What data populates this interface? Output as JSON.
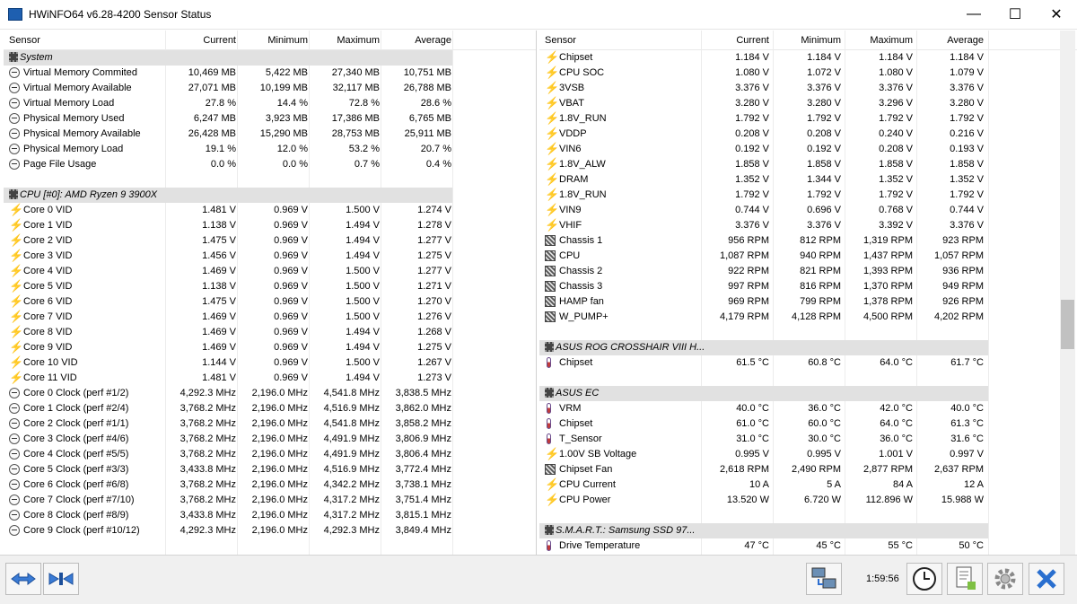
{
  "window": {
    "title": "HWiNFO64 v6.28-4200 Sensor Status",
    "minimize": "—",
    "maximize": "☐",
    "close": "✕"
  },
  "columns": {
    "sensor": "Sensor",
    "current": "Current",
    "minimum": "Minimum",
    "maximum": "Maximum",
    "average": "Average"
  },
  "left_rows": [
    {
      "type": "group",
      "name": "System",
      "icon": "chip-icon"
    },
    {
      "name": "Virtual Memory Commited",
      "icon": "clock-icon",
      "cur": "10,469 MB",
      "min": "5,422 MB",
      "max": "27,340 MB",
      "avg": "10,751 MB"
    },
    {
      "name": "Virtual Memory Available",
      "icon": "clock-icon",
      "cur": "27,071 MB",
      "min": "10,199 MB",
      "max": "32,117 MB",
      "avg": "26,788 MB"
    },
    {
      "name": "Virtual Memory Load",
      "icon": "clock-icon",
      "cur": "27.8 %",
      "min": "14.4 %",
      "max": "72.8 %",
      "avg": "28.6 %"
    },
    {
      "name": "Physical Memory Used",
      "icon": "clock-icon",
      "cur": "6,247 MB",
      "min": "3,923 MB",
      "max": "17,386 MB",
      "avg": "6,765 MB"
    },
    {
      "name": "Physical Memory Available",
      "icon": "clock-icon",
      "cur": "26,428 MB",
      "min": "15,290 MB",
      "max": "28,753 MB",
      "avg": "25,911 MB"
    },
    {
      "name": "Physical Memory Load",
      "icon": "clock-icon",
      "cur": "19.1 %",
      "min": "12.0 %",
      "max": "53.2 %",
      "avg": "20.7 %"
    },
    {
      "name": "Page File Usage",
      "icon": "clock-icon",
      "cur": "0.0 %",
      "min": "0.0 %",
      "max": "0.7 %",
      "avg": "0.4 %"
    },
    {
      "type": "blank"
    },
    {
      "type": "group",
      "name": "CPU [#0]: AMD Ryzen 9 3900X",
      "icon": "chip-icon"
    },
    {
      "name": "Core 0 VID",
      "icon": "voltage-icon",
      "cur": "1.481 V",
      "min": "0.969 V",
      "max": "1.500 V",
      "avg": "1.274 V"
    },
    {
      "name": "Core 1 VID",
      "icon": "voltage-icon",
      "cur": "1.138 V",
      "min": "0.969 V",
      "max": "1.494 V",
      "avg": "1.278 V"
    },
    {
      "name": "Core 2 VID",
      "icon": "voltage-icon",
      "cur": "1.475 V",
      "min": "0.969 V",
      "max": "1.494 V",
      "avg": "1.277 V"
    },
    {
      "name": "Core 3 VID",
      "icon": "voltage-icon",
      "cur": "1.456 V",
      "min": "0.969 V",
      "max": "1.494 V",
      "avg": "1.275 V"
    },
    {
      "name": "Core 4 VID",
      "icon": "voltage-icon",
      "cur": "1.469 V",
      "min": "0.969 V",
      "max": "1.500 V",
      "avg": "1.277 V"
    },
    {
      "name": "Core 5 VID",
      "icon": "voltage-icon",
      "cur": "1.138 V",
      "min": "0.969 V",
      "max": "1.500 V",
      "avg": "1.271 V"
    },
    {
      "name": "Core 6 VID",
      "icon": "voltage-icon",
      "cur": "1.475 V",
      "min": "0.969 V",
      "max": "1.500 V",
      "avg": "1.270 V"
    },
    {
      "name": "Core 7 VID",
      "icon": "voltage-icon",
      "cur": "1.469 V",
      "min": "0.969 V",
      "max": "1.500 V",
      "avg": "1.276 V"
    },
    {
      "name": "Core 8 VID",
      "icon": "voltage-icon",
      "cur": "1.469 V",
      "min": "0.969 V",
      "max": "1.494 V",
      "avg": "1.268 V"
    },
    {
      "name": "Core 9 VID",
      "icon": "voltage-icon",
      "cur": "1.469 V",
      "min": "0.969 V",
      "max": "1.494 V",
      "avg": "1.275 V"
    },
    {
      "name": "Core 10 VID",
      "icon": "voltage-icon",
      "cur": "1.144 V",
      "min": "0.969 V",
      "max": "1.500 V",
      "avg": "1.267 V"
    },
    {
      "name": "Core 11 VID",
      "icon": "voltage-icon",
      "cur": "1.481 V",
      "min": "0.969 V",
      "max": "1.494 V",
      "avg": "1.273 V"
    },
    {
      "name": "Core 0 Clock (perf #1/2)",
      "icon": "clock-icon",
      "cur": "4,292.3 MHz",
      "min": "2,196.0 MHz",
      "max": "4,541.8 MHz",
      "avg": "3,838.5 MHz"
    },
    {
      "name": "Core 1 Clock (perf #2/4)",
      "icon": "clock-icon",
      "cur": "3,768.2 MHz",
      "min": "2,196.0 MHz",
      "max": "4,516.9 MHz",
      "avg": "3,862.0 MHz"
    },
    {
      "name": "Core 2 Clock (perf #1/1)",
      "icon": "clock-icon",
      "cur": "3,768.2 MHz",
      "min": "2,196.0 MHz",
      "max": "4,541.8 MHz",
      "avg": "3,858.2 MHz"
    },
    {
      "name": "Core 3 Clock (perf #4/6)",
      "icon": "clock-icon",
      "cur": "3,768.2 MHz",
      "min": "2,196.0 MHz",
      "max": "4,491.9 MHz",
      "avg": "3,806.9 MHz"
    },
    {
      "name": "Core 4 Clock (perf #5/5)",
      "icon": "clock-icon",
      "cur": "3,768.2 MHz",
      "min": "2,196.0 MHz",
      "max": "4,491.9 MHz",
      "avg": "3,806.4 MHz"
    },
    {
      "name": "Core 5 Clock (perf #3/3)",
      "icon": "clock-icon",
      "cur": "3,433.8 MHz",
      "min": "2,196.0 MHz",
      "max": "4,516.9 MHz",
      "avg": "3,772.4 MHz"
    },
    {
      "name": "Core 6 Clock (perf #6/8)",
      "icon": "clock-icon",
      "cur": "3,768.2 MHz",
      "min": "2,196.0 MHz",
      "max": "4,342.2 MHz",
      "avg": "3,738.1 MHz"
    },
    {
      "name": "Core 7 Clock (perf #7/10)",
      "icon": "clock-icon",
      "cur": "3,768.2 MHz",
      "min": "2,196.0 MHz",
      "max": "4,317.2 MHz",
      "avg": "3,751.4 MHz"
    },
    {
      "name": "Core 8 Clock (perf #8/9)",
      "icon": "clock-icon",
      "cur": "3,433.8 MHz",
      "min": "2,196.0 MHz",
      "max": "4,317.2 MHz",
      "avg": "3,815.1 MHz"
    },
    {
      "name": "Core 9 Clock (perf #10/12)",
      "icon": "clock-icon",
      "cur": "4,292.3 MHz",
      "min": "2,196.0 MHz",
      "max": "4,292.3 MHz",
      "avg": "3,849.4 MHz"
    }
  ],
  "right_rows": [
    {
      "name": "Chipset",
      "icon": "voltage-icon",
      "cur": "1.184 V",
      "min": "1.184 V",
      "max": "1.184 V",
      "avg": "1.184 V"
    },
    {
      "name": "CPU SOC",
      "icon": "voltage-icon",
      "cur": "1.080 V",
      "min": "1.072 V",
      "max": "1.080 V",
      "avg": "1.079 V"
    },
    {
      "name": "3VSB",
      "icon": "voltage-icon",
      "cur": "3.376 V",
      "min": "3.376 V",
      "max": "3.376 V",
      "avg": "3.376 V"
    },
    {
      "name": "VBAT",
      "icon": "voltage-icon",
      "cur": "3.280 V",
      "min": "3.280 V",
      "max": "3.296 V",
      "avg": "3.280 V"
    },
    {
      "name": "1.8V_RUN",
      "icon": "voltage-icon",
      "cur": "1.792 V",
      "min": "1.792 V",
      "max": "1.792 V",
      "avg": "1.792 V"
    },
    {
      "name": "VDDP",
      "icon": "voltage-icon",
      "cur": "0.208 V",
      "min": "0.208 V",
      "max": "0.240 V",
      "avg": "0.216 V"
    },
    {
      "name": "VIN6",
      "icon": "voltage-icon",
      "cur": "0.192 V",
      "min": "0.192 V",
      "max": "0.208 V",
      "avg": "0.193 V"
    },
    {
      "name": "1.8V_ALW",
      "icon": "voltage-icon",
      "cur": "1.858 V",
      "min": "1.858 V",
      "max": "1.858 V",
      "avg": "1.858 V"
    },
    {
      "name": "DRAM",
      "icon": "voltage-icon",
      "cur": "1.352 V",
      "min": "1.344 V",
      "max": "1.352 V",
      "avg": "1.352 V"
    },
    {
      "name": "1.8V_RUN",
      "icon": "voltage-icon",
      "cur": "1.792 V",
      "min": "1.792 V",
      "max": "1.792 V",
      "avg": "1.792 V"
    },
    {
      "name": "VIN9",
      "icon": "voltage-icon",
      "cur": "0.744 V",
      "min": "0.696 V",
      "max": "0.768 V",
      "avg": "0.744 V"
    },
    {
      "name": "VHIF",
      "icon": "voltage-icon",
      "cur": "3.376 V",
      "min": "3.376 V",
      "max": "3.392 V",
      "avg": "3.376 V"
    },
    {
      "name": "Chassis 1",
      "icon": "fan-icon",
      "cur": "956 RPM",
      "min": "812 RPM",
      "max": "1,319 RPM",
      "avg": "923 RPM"
    },
    {
      "name": "CPU",
      "icon": "fan-icon",
      "cur": "1,087 RPM",
      "min": "940 RPM",
      "max": "1,437 RPM",
      "avg": "1,057 RPM"
    },
    {
      "name": "Chassis 2",
      "icon": "fan-icon",
      "cur": "922 RPM",
      "min": "821 RPM",
      "max": "1,393 RPM",
      "avg": "936 RPM"
    },
    {
      "name": "Chassis 3",
      "icon": "fan-icon",
      "cur": "997 RPM",
      "min": "816 RPM",
      "max": "1,370 RPM",
      "avg": "949 RPM"
    },
    {
      "name": "HAMP fan",
      "icon": "fan-icon",
      "cur": "969 RPM",
      "min": "799 RPM",
      "max": "1,378 RPM",
      "avg": "926 RPM"
    },
    {
      "name": "W_PUMP+",
      "icon": "fan-icon",
      "cur": "4,179 RPM",
      "min": "4,128 RPM",
      "max": "4,500 RPM",
      "avg": "4,202 RPM"
    },
    {
      "type": "blank"
    },
    {
      "type": "group",
      "name": "ASUS ROG CROSSHAIR VIII H...",
      "icon": "chip-icon"
    },
    {
      "name": "Chipset",
      "icon": "temperature-icon",
      "cur": "61.5 °C",
      "min": "60.8 °C",
      "max": "64.0 °C",
      "avg": "61.7 °C"
    },
    {
      "type": "blank"
    },
    {
      "type": "group",
      "name": "ASUS EC",
      "icon": "chip-icon"
    },
    {
      "name": "VRM",
      "icon": "temperature-icon",
      "cur": "40.0 °C",
      "min": "36.0 °C",
      "max": "42.0 °C",
      "avg": "40.0 °C"
    },
    {
      "name": "Chipset",
      "icon": "temperature-icon",
      "cur": "61.0 °C",
      "min": "60.0 °C",
      "max": "64.0 °C",
      "avg": "61.3 °C"
    },
    {
      "name": "T_Sensor",
      "icon": "temperature-icon",
      "cur": "31.0 °C",
      "min": "30.0 °C",
      "max": "36.0 °C",
      "avg": "31.6 °C"
    },
    {
      "name": "1.00V SB Voltage",
      "icon": "voltage-icon",
      "cur": "0.995 V",
      "min": "0.995 V",
      "max": "1.001 V",
      "avg": "0.997 V"
    },
    {
      "name": "Chipset Fan",
      "icon": "fan-icon",
      "cur": "2,618 RPM",
      "min": "2,490 RPM",
      "max": "2,877 RPM",
      "avg": "2,637 RPM"
    },
    {
      "name": "CPU Current",
      "icon": "voltage-icon",
      "cur": "10 A",
      "min": "5 A",
      "max": "84 A",
      "avg": "12 A"
    },
    {
      "name": "CPU Power",
      "icon": "voltage-icon",
      "cur": "13.520 W",
      "min": "6.720 W",
      "max": "112.896 W",
      "avg": "15.988 W"
    },
    {
      "type": "blank"
    },
    {
      "type": "group",
      "name": "S.M.A.R.T.: Samsung SSD 97...",
      "icon": "chip-icon"
    },
    {
      "name": "Drive Temperature",
      "icon": "temperature-icon",
      "cur": "47 °C",
      "min": "45 °C",
      "max": "55 °C",
      "avg": "50 °C"
    }
  ],
  "status": {
    "elapsed": "1:59:56"
  },
  "toolbar": {
    "left_buttons": [
      "arrows-left-right-icon",
      "arrows-collapse-icon"
    ],
    "right_buttons": [
      "network-icon",
      "clock-reset-icon",
      "report-icon",
      "settings-icon",
      "close-icon"
    ]
  }
}
